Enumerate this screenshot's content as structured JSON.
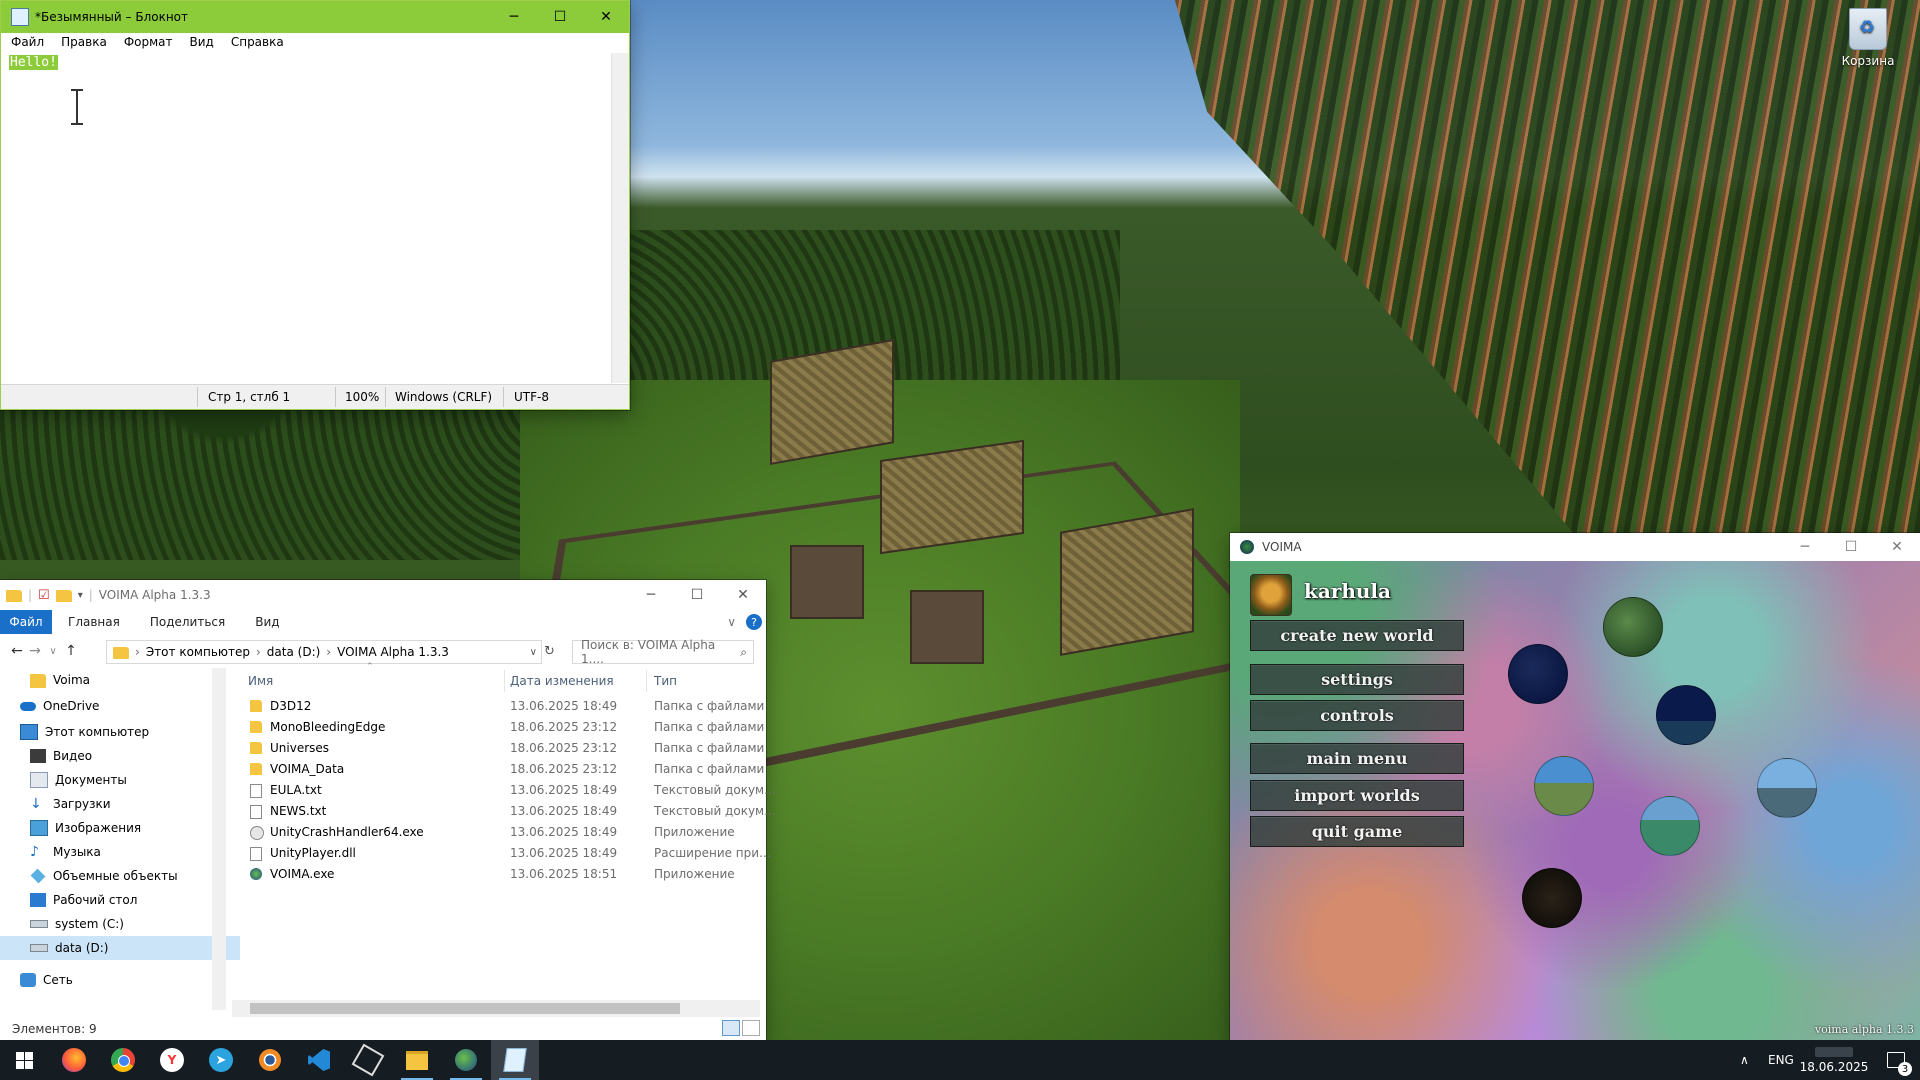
{
  "desktop": {
    "recycle_bin_label": "Корзина"
  },
  "notepad": {
    "title": "*Безымянный – Блокнот",
    "menu": [
      "Файл",
      "Правка",
      "Формат",
      "Вид",
      "Справка"
    ],
    "content": "Hello!",
    "status": {
      "position": "Стр 1, стлб 1",
      "zoom": "100%",
      "line_ending": "Windows (CRLF)",
      "encoding": "UTF-8"
    }
  },
  "explorer": {
    "title": "VOIMA Alpha 1.3.3",
    "ribbon_tabs": [
      "Файл",
      "Главная",
      "Поделиться",
      "Вид"
    ],
    "breadcrumb": [
      "Этот компьютер",
      "data (D:)",
      "VOIMA Alpha 1.3.3"
    ],
    "search_placeholder": "Поиск в: VOIMA Alpha 1....",
    "nav_pane": [
      {
        "label": "Voima",
        "icon": "folder-icon"
      },
      {
        "label": "OneDrive",
        "icon": "onedrive-icon"
      },
      {
        "label": "Этот компьютер",
        "icon": "computer-icon"
      },
      {
        "label": "Видео",
        "icon": "video-icon"
      },
      {
        "label": "Документы",
        "icon": "documents-icon"
      },
      {
        "label": "Загрузки",
        "icon": "downloads-icon"
      },
      {
        "label": "Изображения",
        "icon": "pictures-icon"
      },
      {
        "label": "Музыка",
        "icon": "music-icon"
      },
      {
        "label": "Объемные объекты",
        "icon": "3d-objects-icon"
      },
      {
        "label": "Рабочий стол",
        "icon": "desktop-icon"
      },
      {
        "label": "system (C:)",
        "icon": "drive-icon"
      },
      {
        "label": "data (D:)",
        "icon": "drive-icon"
      },
      {
        "label": "Сеть",
        "icon": "network-icon"
      }
    ],
    "columns": {
      "name": "Имя",
      "date": "Дата изменения",
      "type": "Тип"
    },
    "files": [
      {
        "name": "D3D12",
        "date": "13.06.2025 18:49",
        "type": "Папка с файлами",
        "icon": "folder-icon"
      },
      {
        "name": "MonoBleedingEdge",
        "date": "18.06.2025 23:12",
        "type": "Папка с файлами",
        "icon": "folder-icon"
      },
      {
        "name": "Universes",
        "date": "18.06.2025 23:12",
        "type": "Папка с файлами",
        "icon": "folder-icon"
      },
      {
        "name": "VOIMA_Data",
        "date": "18.06.2025 23:12",
        "type": "Папка с файлами",
        "icon": "folder-icon"
      },
      {
        "name": "EULA.txt",
        "date": "13.06.2025 18:49",
        "type": "Текстовый докум...",
        "icon": "text-file-icon"
      },
      {
        "name": "NEWS.txt",
        "date": "13.06.2025 18:49",
        "type": "Текстовый докум...",
        "icon": "text-file-icon"
      },
      {
        "name": "UnityCrashHandler64.exe",
        "date": "13.06.2025 18:49",
        "type": "Приложение",
        "icon": "exe-icon"
      },
      {
        "name": "UnityPlayer.dll",
        "date": "13.06.2025 18:49",
        "type": "Расширение при...",
        "icon": "dll-icon"
      },
      {
        "name": "VOIMA.exe",
        "date": "13.06.2025 18:51",
        "type": "Приложение",
        "icon": "voima-icon"
      }
    ],
    "status": "Элементов: 9"
  },
  "voima": {
    "title": "VOIMA",
    "username": "karhula",
    "buttons": [
      "create new world",
      "settings",
      "controls",
      "main menu",
      "import worlds",
      "quit game"
    ],
    "version": "voima alpha 1.3.3"
  },
  "taskbar": {
    "apps": [
      "start-icon",
      "firefox-icon",
      "chrome-icon",
      "yandex-browser-icon",
      "telegram-icon",
      "blender-icon",
      "vscode-icon",
      "unity-icon",
      "file-explorer-icon",
      "voima-icon",
      "notepad-icon"
    ],
    "language": "ENG",
    "date": "18.06.2025",
    "notification_count": "3"
  }
}
